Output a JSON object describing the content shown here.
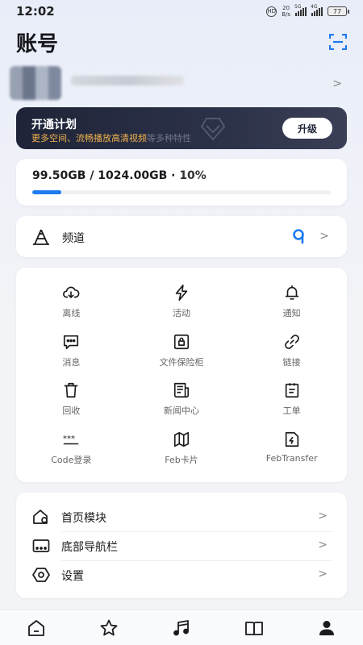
{
  "status_bar": {
    "time": "12:02",
    "speed_value": "20",
    "speed_unit": "B/s",
    "signal1_label": "5G",
    "signal2_label": "4G",
    "battery": "77"
  },
  "header": {
    "title": "账号"
  },
  "plan": {
    "title": "开通计划",
    "subtitle": "更多空间、流畅播放高清视频",
    "subtitle_faded": "等多种特性",
    "upgrade_label": "升级"
  },
  "storage": {
    "text": "99.50GB / 1024.00GB",
    "separator": " · ",
    "percent_label": "10%",
    "percent_value": 0.097,
    "accent": "#1d7af0"
  },
  "channel": {
    "label": "频道",
    "icon": "tower-icon",
    "badge_icon": "channel-badge-icon"
  },
  "grid": {
    "items": [
      {
        "label": "离线",
        "icon": "cloud-download-icon"
      },
      {
        "label": "活动",
        "icon": "lightning-icon"
      },
      {
        "label": "通知",
        "icon": "bell-icon"
      },
      {
        "label": "消息",
        "icon": "chat-bubble-icon"
      },
      {
        "label": "文件保险柜",
        "icon": "lock-box-icon"
      },
      {
        "label": "链接",
        "icon": "link-icon"
      },
      {
        "label": "回收",
        "icon": "trash-icon"
      },
      {
        "label": "新闻中心",
        "icon": "news-icon"
      },
      {
        "label": "工单",
        "icon": "clipboard-icon"
      },
      {
        "label": "Code登录",
        "icon": "asterisk-code-icon"
      },
      {
        "label": "Feb卡片",
        "icon": "card-map-icon"
      },
      {
        "label": "FebTransfer",
        "icon": "transfer-icon"
      }
    ]
  },
  "menu": {
    "items": [
      {
        "label": "首页模块",
        "icon": "home-settings-icon"
      },
      {
        "label": "底部导航栏",
        "icon": "navbar-icon"
      },
      {
        "label": "设置",
        "icon": "hexagon-settings-icon"
      }
    ]
  },
  "bottom_nav": {
    "items": [
      {
        "icon": "home-icon"
      },
      {
        "icon": "star-icon"
      },
      {
        "icon": "music-icon"
      },
      {
        "icon": "book-icon"
      },
      {
        "icon": "profile-icon"
      }
    ]
  }
}
